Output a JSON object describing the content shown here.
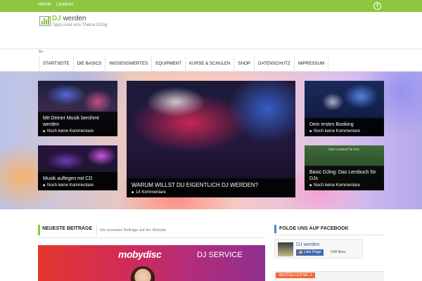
{
  "topbar": {
    "links": [
      "Home",
      "Lexikon"
    ],
    "facebook_icon": "f"
  },
  "site": {
    "title_accent": "DJ",
    "title_rest": " werden",
    "tagline": "Tipps rund ums Thema DJing"
  },
  "menu_toggle": "≡⌐",
  "nav": {
    "items": [
      "STARTSEITE",
      "DIE BASICS",
      "WISSENSWERTES",
      "EQUIPMENT",
      "KURSE & SCHULEN",
      "SHOP",
      "DATENSCHUTZ",
      "IMPRESSUM"
    ]
  },
  "hero": {
    "left": [
      {
        "title": "Mit Deiner Musik berühmt werden",
        "comments": "Noch keine Kommentare"
      },
      {
        "title": "Musik auflegen mit CD",
        "comments": "Noch keine Kommentare"
      }
    ],
    "featured": {
      "title": "WARUM WILLST DU EIGENTLICH DJ WERDEN?",
      "comments": "14 Kommentare"
    },
    "right": [
      {
        "title": "Dein erstes Booking",
        "comments": "Noch keine Kommentare"
      },
      {
        "title": "Basic DJing: Das Lernbuch für DJs",
        "comments": "Noch keine Kommentare",
        "image_caption": "Das Lernbuch für DJs"
      }
    ]
  },
  "latest": {
    "title": "NEUESTE BEITRÄGE",
    "subtitle": "Die neuesten Beiträge auf der Website"
  },
  "banner": {
    "brand": "mobydisc",
    "service": "DJ SERVICE"
  },
  "facebook": {
    "heading": "FOLGE UNS AUF FACEBOOK",
    "page_name": "DJ werden",
    "like_label": "Like Page",
    "likes": "648 likes"
  },
  "bestseller": {
    "label": "BESTSELLER NR. 1"
  },
  "colors": {
    "accent": "#8dc63f",
    "facebook_blue": "#4267b2",
    "widget_accent": "#3b8fd8"
  }
}
